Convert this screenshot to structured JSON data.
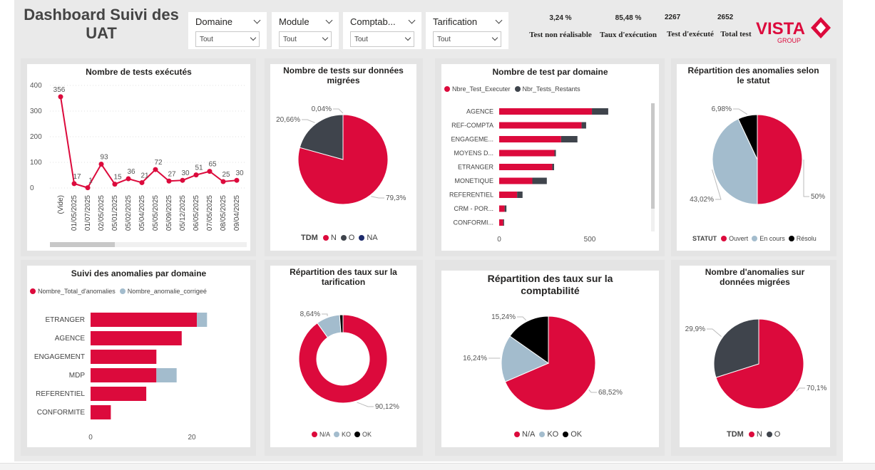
{
  "header": {
    "title": "Dashboard Suivi des UAT"
  },
  "slicers": [
    {
      "label": "Domaine",
      "value": "Tout"
    },
    {
      "label": "Module",
      "value": "Tout"
    },
    {
      "label": "Comptab...",
      "value": "Tout"
    },
    {
      "label": "Tarification",
      "value": "Tout"
    }
  ],
  "kpis": [
    {
      "value": "3,24 %",
      "label": "Test non réalisable"
    },
    {
      "value": "85,48 %",
      "label": "Taux d'exécution"
    },
    {
      "value": "2267",
      "label": "Test d'exécuté"
    },
    {
      "value": "2652",
      "label": "Total test"
    }
  ],
  "logo": {
    "text": "VISTA",
    "sub": "GROUP"
  },
  "colors": {
    "red": "#dc0a3c",
    "dark": "#3f444c",
    "light": "#a3bccd",
    "black": "#000000",
    "navy": "#1d2a6b"
  },
  "chart_data": [
    {
      "type": "line",
      "title": "Nombre de tests exécutés",
      "categories": [
        "(Vide)",
        "01/05/2025",
        "01/07/2025",
        "02/05/2025",
        "05/01/2025",
        "05/02/2025",
        "05/04/2025",
        "05/05/2025",
        "05/09/2025",
        "05/12/2025",
        "06/05/2025",
        "07/05/2025",
        "08/05/2025",
        "09/04/2025"
      ],
      "values": [
        356,
        17,
        1,
        93,
        15,
        36,
        21,
        72,
        27,
        30,
        51,
        65,
        25,
        30
      ],
      "ylim": [
        0,
        400
      ],
      "yticks": [
        0,
        100,
        200,
        300,
        400
      ]
    },
    {
      "type": "pie",
      "title": "Nombre de tests sur données migrées",
      "legend_title": "TDM",
      "slices": [
        {
          "name": "N",
          "value": 79.3,
          "label": "79,3%",
          "color": "#dc0a3c"
        },
        {
          "name": "O",
          "value": 20.66,
          "label": "20,66%",
          "color": "#3f444c"
        },
        {
          "name": "NA",
          "value": 0.04,
          "label": "0,04%",
          "color": "#1d2a6b"
        }
      ]
    },
    {
      "type": "bar",
      "title": "Nombre de test par domaine",
      "categories": [
        "AGENCE",
        "REF-COMPTA",
        "ENGAGEME...",
        "MOYENS D...",
        "ETRANGER",
        "MONETIQUE",
        "REFERENTIEL",
        "CRM - POR...",
        "CONFORMI..."
      ],
      "series": [
        {
          "name": "Nbre_Test_Executer",
          "values": [
            512,
            455,
            342,
            305,
            293,
            183,
            99,
            30,
            22
          ],
          "color": "#dc0a3c"
        },
        {
          "name": "Nbr_Tests_Restants",
          "values": [
            90,
            25,
            90,
            8,
            10,
            80,
            30,
            10,
            5
          ],
          "color": "#3f444c"
        }
      ],
      "xticks": [
        0,
        500
      ]
    },
    {
      "type": "pie",
      "title": "Répartition des anomalies selon le statut",
      "legend_title": "STATUT",
      "slices": [
        {
          "name": "Ouvert",
          "value": 50,
          "label": "50%",
          "color": "#dc0a3c"
        },
        {
          "name": "En cours",
          "value": 43.02,
          "label": "43,02%",
          "color": "#a3bccd"
        },
        {
          "name": "Résolu",
          "value": 6.98,
          "label": "6,98%",
          "color": "#000000"
        }
      ]
    },
    {
      "type": "bar",
      "title": "Suivi des anomalies par domaine",
      "categories": [
        "ETRANGER",
        "AGENCE",
        "ENGAGEMENT",
        "MDP",
        "REFERENTIEL",
        "CONFORMITE"
      ],
      "series": [
        {
          "name": "Nombre_Total_d'anomalies",
          "values": [
            21,
            18,
            13,
            13,
            11,
            4
          ],
          "color": "#dc0a3c"
        },
        {
          "name": "Nombre_anomalie_corrigeé",
          "values": [
            2,
            0,
            0,
            4,
            0,
            0
          ],
          "color": "#a3bccd"
        }
      ],
      "xticks": [
        0,
        20
      ]
    },
    {
      "type": "pie",
      "title": "Répartition des taux sur la tarification",
      "donut": true,
      "slices": [
        {
          "name": "N/A",
          "value": 90.12,
          "label": "90,12%",
          "color": "#dc0a3c"
        },
        {
          "name": "KO",
          "value": 8.64,
          "label": "8,64%",
          "color": "#a3bccd"
        },
        {
          "name": "OK",
          "value": 1.24,
          "label": "",
          "color": "#000000"
        }
      ]
    },
    {
      "type": "pie",
      "title": "Répartition des taux sur la comptabilité",
      "slices": [
        {
          "name": "N/A",
          "value": 68.52,
          "label": "68,52%",
          "color": "#dc0a3c"
        },
        {
          "name": "KO",
          "value": 16.24,
          "label": "16,24%",
          "color": "#a3bccd"
        },
        {
          "name": "OK",
          "value": 15.24,
          "label": "15,24%",
          "color": "#000000"
        }
      ]
    },
    {
      "type": "pie",
      "title": "Nombre d'anomalies sur données migrées",
      "legend_title": "TDM",
      "slices": [
        {
          "name": "N",
          "value": 70.1,
          "label": "70,1%",
          "color": "#dc0a3c"
        },
        {
          "name": "O",
          "value": 29.9,
          "label": "29,9%",
          "color": "#3f444c"
        }
      ]
    }
  ]
}
